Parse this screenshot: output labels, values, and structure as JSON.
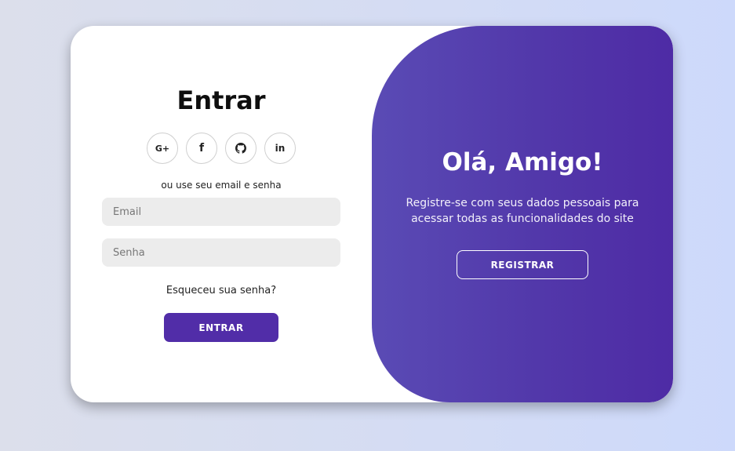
{
  "login": {
    "title": "Entrar",
    "socials": [
      {
        "name": "google-plus",
        "label": "G+"
      },
      {
        "name": "facebook",
        "label": "f"
      },
      {
        "name": "github",
        "label": ""
      },
      {
        "name": "linkedin",
        "label": "in"
      }
    ],
    "alt_text": "ou use seu email e senha",
    "email_placeholder": "Email",
    "password_placeholder": "Senha",
    "forgot_link": "Esqueceu sua senha?",
    "submit_label": "ENTRAR"
  },
  "panel": {
    "title": "Olá, Amigo!",
    "text": "Registre-se com seus dados pessoais para acessar todas as funcionalidades do site",
    "register_label": "REGISTRAR"
  },
  "colors": {
    "primary": "#512da8",
    "panel_gradient_start": "#5a4bb5",
    "panel_gradient_end": "#4e2ba5",
    "input_bg": "#ececec"
  }
}
